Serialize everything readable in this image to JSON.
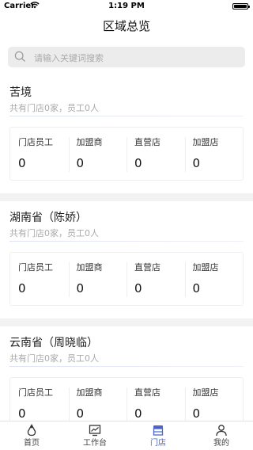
{
  "status_bar": {
    "carrier": "Carrier",
    "time": "1:19 PM"
  },
  "header": {
    "title": "区域总览"
  },
  "search": {
    "placeholder": "请输入关键词搜索"
  },
  "regions": [
    {
      "name": "苦境",
      "summary": "共有门店0家，员工0人",
      "stats": [
        {
          "label": "门店员工",
          "value": "0"
        },
        {
          "label": "加盟商",
          "value": "0"
        },
        {
          "label": "直营店",
          "value": "0"
        },
        {
          "label": "加盟店",
          "value": "0"
        }
      ]
    },
    {
      "name": "湖南省（陈娇）",
      "summary": "共有门店0家，员工0人",
      "stats": [
        {
          "label": "门店员工",
          "value": "0"
        },
        {
          "label": "加盟商",
          "value": "0"
        },
        {
          "label": "直营店",
          "value": "0"
        },
        {
          "label": "加盟店",
          "value": "0"
        }
      ]
    },
    {
      "name": "云南省（周晓临）",
      "summary": "共有门店0家，员工0人",
      "stats": [
        {
          "label": "门店员工",
          "value": "0"
        },
        {
          "label": "加盟商",
          "value": "0"
        },
        {
          "label": "直营店",
          "value": "0"
        },
        {
          "label": "加盟店",
          "value": "0"
        }
      ]
    }
  ],
  "tab_bar": {
    "active_color": "#4a66c8",
    "items": [
      {
        "label": "首页",
        "icon": "home-icon"
      },
      {
        "label": "工作台",
        "icon": "dashboard-icon"
      },
      {
        "label": "门店",
        "icon": "store-icon",
        "active": true
      },
      {
        "label": "我的",
        "icon": "user-icon"
      }
    ]
  }
}
